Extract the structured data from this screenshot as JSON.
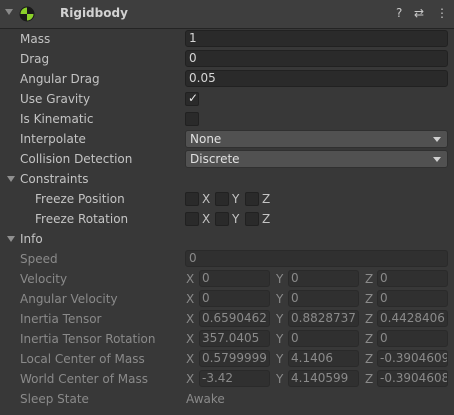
{
  "header": {
    "title": "Rigidbody",
    "help_glyph": "?",
    "preset_glyph": "⇄",
    "menu_glyph": "⋮"
  },
  "props": {
    "mass": {
      "label": "Mass",
      "value": "1"
    },
    "drag": {
      "label": "Drag",
      "value": "0"
    },
    "angular_drag": {
      "label": "Angular Drag",
      "value": "0.05"
    },
    "use_gravity": {
      "label": "Use Gravity",
      "checked": true,
      "check_glyph": "✓"
    },
    "is_kinematic": {
      "label": "Is Kinematic",
      "checked": false
    },
    "interpolate": {
      "label": "Interpolate",
      "value": "None"
    },
    "collision_detection": {
      "label": "Collision Detection",
      "value": "Discrete"
    }
  },
  "constraints": {
    "label": "Constraints",
    "freeze_position": {
      "label": "Freeze Position",
      "x": "X",
      "y": "Y",
      "z": "Z"
    },
    "freeze_rotation": {
      "label": "Freeze Rotation",
      "x": "X",
      "y": "Y",
      "z": "Z"
    }
  },
  "info": {
    "label": "Info",
    "speed": {
      "label": "Speed",
      "value": "0"
    },
    "velocity": {
      "label": "Velocity",
      "x": "0",
      "y": "0",
      "z": "0"
    },
    "angular_velocity": {
      "label": "Angular Velocity",
      "x": "0",
      "y": "0",
      "z": "0"
    },
    "inertia_tensor": {
      "label": "Inertia Tensor",
      "x": "0.6590462",
      "y": "0.8828737",
      "z": "0.4428406"
    },
    "inertia_tensor_rotation": {
      "label": "Inertia Tensor Rotation",
      "x": "357.0405",
      "y": "0",
      "z": "0"
    },
    "local_center_of_mass": {
      "label": "Local Center of Mass",
      "x": "0.5799999",
      "y": "4.1406",
      "z": "-0.3904609"
    },
    "world_center_of_mass": {
      "label": "World Center of Mass",
      "x": "-3.42",
      "y": "4.140599",
      "z": "-0.3904608"
    },
    "sleep_state": {
      "label": "Sleep State",
      "value": "Awake"
    }
  },
  "axis": {
    "x": "X",
    "y": "Y",
    "z": "Z"
  },
  "colors": {
    "background": "#383838",
    "header": "#3e3e3e",
    "field": "#2a2a2a",
    "dropdown": "#515151",
    "icon_green": "#8bd12a"
  }
}
